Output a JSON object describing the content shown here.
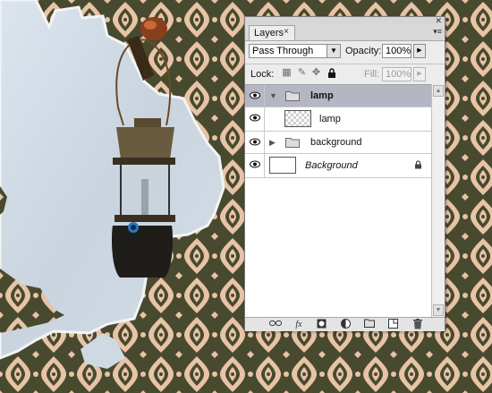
{
  "panel": {
    "tab_label": "Layers",
    "tab_close": "×",
    "blend_mode": "Pass Through",
    "opacity_label": "Opacity:",
    "opacity_value": "100%",
    "lock_label": "Lock:",
    "fill_label": "Fill:",
    "fill_value": "100%"
  },
  "layers": [
    {
      "name": "lamp",
      "type": "group",
      "expanded": true,
      "selected": true
    },
    {
      "name": "lamp",
      "type": "layer",
      "thumbnail": "transparent",
      "selected": false
    },
    {
      "name": "background",
      "type": "group",
      "expanded": false,
      "selected": false
    },
    {
      "name": "Background",
      "type": "layer",
      "thumbnail": "white",
      "locked": true,
      "italic": true,
      "selected": false
    }
  ],
  "footer_icons": [
    "link-layers-icon",
    "fx-icon",
    "layer-mask-icon",
    "adjustment-layer-icon",
    "new-group-icon",
    "new-layer-icon",
    "trash-icon"
  ],
  "footer_glyphs": {
    "fx": "fx"
  },
  "colors": {
    "pattern_dark": "#474a2f",
    "pattern_light": "#e8c3a6",
    "plaster": "#cdd8e3",
    "selection": "#b4b6c3"
  }
}
